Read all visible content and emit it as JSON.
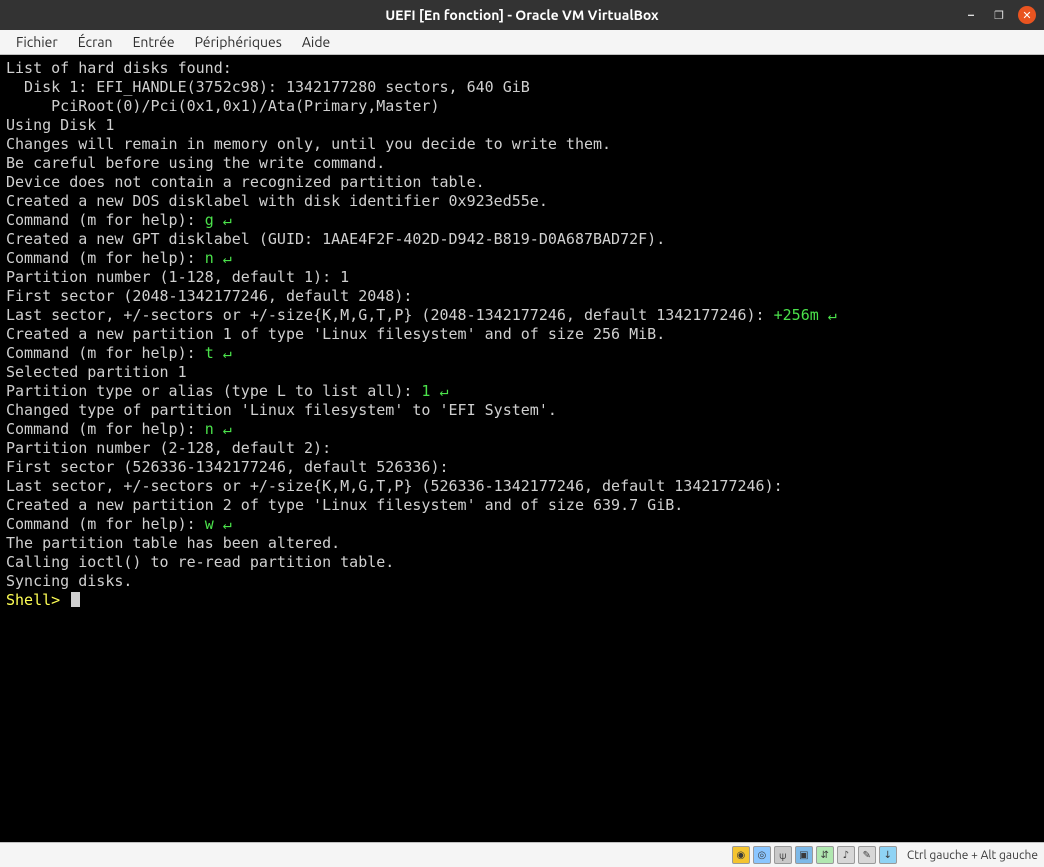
{
  "titlebar": {
    "title": "UEFI [En fonction] - Oracle VM VirtualBox"
  },
  "menubar": {
    "items": [
      "Fichier",
      "Écran",
      "Entrée",
      "Périphériques",
      "Aide"
    ]
  },
  "terminal": {
    "lines": [
      {
        "t": "List of hard disks found:"
      },
      {
        "t": "  Disk 1: EFI_HANDLE(3752c98): 1342177280 sectors, 640 GiB"
      },
      {
        "t": "     PciRoot(0)/Pci(0x1,0x1)/Ata(Primary,Master)"
      },
      {
        "t": ""
      },
      {
        "t": "Using Disk 1"
      },
      {
        "t": ""
      },
      {
        "t": "Changes will remain in memory only, until you decide to write them."
      },
      {
        "t": "Be careful before using the write command."
      },
      {
        "t": ""
      },
      {
        "t": "Device does not contain a recognized partition table."
      },
      {
        "t": "Created a new DOS disklabel with disk identifier 0x923ed55e."
      },
      {
        "t": ""
      },
      {
        "pre": "Command (m for help): ",
        "in": "g ",
        "enter": true
      },
      {
        "t": "Created a new GPT disklabel (GUID: 1AAE4F2F-402D-D942-B819-D0A687BAD72F)."
      },
      {
        "t": ""
      },
      {
        "pre": "Command (m for help): ",
        "in": "n ",
        "enter": true
      },
      {
        "t": "Partition number (1-128, default 1): 1"
      },
      {
        "t": "First sector (2048-1342177246, default 2048):"
      },
      {
        "pre": "Last sector, +/-sectors or +/-size{K,M,G,T,P} (2048-1342177246, default 1342177246): ",
        "in": "+256m ",
        "enter": true
      },
      {
        "t": ""
      },
      {
        "t": "Created a new partition 1 of type 'Linux filesystem' and of size 256 MiB."
      },
      {
        "t": ""
      },
      {
        "pre": "Command (m for help): ",
        "in": "t ",
        "enter": true
      },
      {
        "t": "Selected partition 1"
      },
      {
        "pre": "Partition type or alias (type L to list all): ",
        "in": "1 ",
        "enter": true
      },
      {
        "t": "Changed type of partition 'Linux filesystem' to 'EFI System'."
      },
      {
        "t": ""
      },
      {
        "pre": "Command (m for help): ",
        "in": "n ",
        "enter": true
      },
      {
        "t": "Partition number (2-128, default 2):"
      },
      {
        "t": "First sector (526336-1342177246, default 526336):"
      },
      {
        "t": "Last sector, +/-sectors or +/-size{K,M,G,T,P} (526336-1342177246, default 1342177246):"
      },
      {
        "t": ""
      },
      {
        "t": "Created a new partition 2 of type 'Linux filesystem' and of size 639.7 GiB."
      },
      {
        "t": ""
      },
      {
        "pre": "Command (m for help): ",
        "in": "w ",
        "enter": true
      },
      {
        "t": "The partition table has been altered."
      },
      {
        "t": "Calling ioctl() to re-read partition table."
      },
      {
        "t": "Syncing disks."
      },
      {
        "t": ""
      },
      {
        "prompt": "Shell> ",
        "cursor": true
      }
    ]
  },
  "statusbar": {
    "host_key": "Ctrl gauche + Alt gauche",
    "icons": [
      "disk",
      "opt",
      "usb",
      "fold",
      "net",
      "snd",
      "mouse",
      "rec"
    ]
  }
}
